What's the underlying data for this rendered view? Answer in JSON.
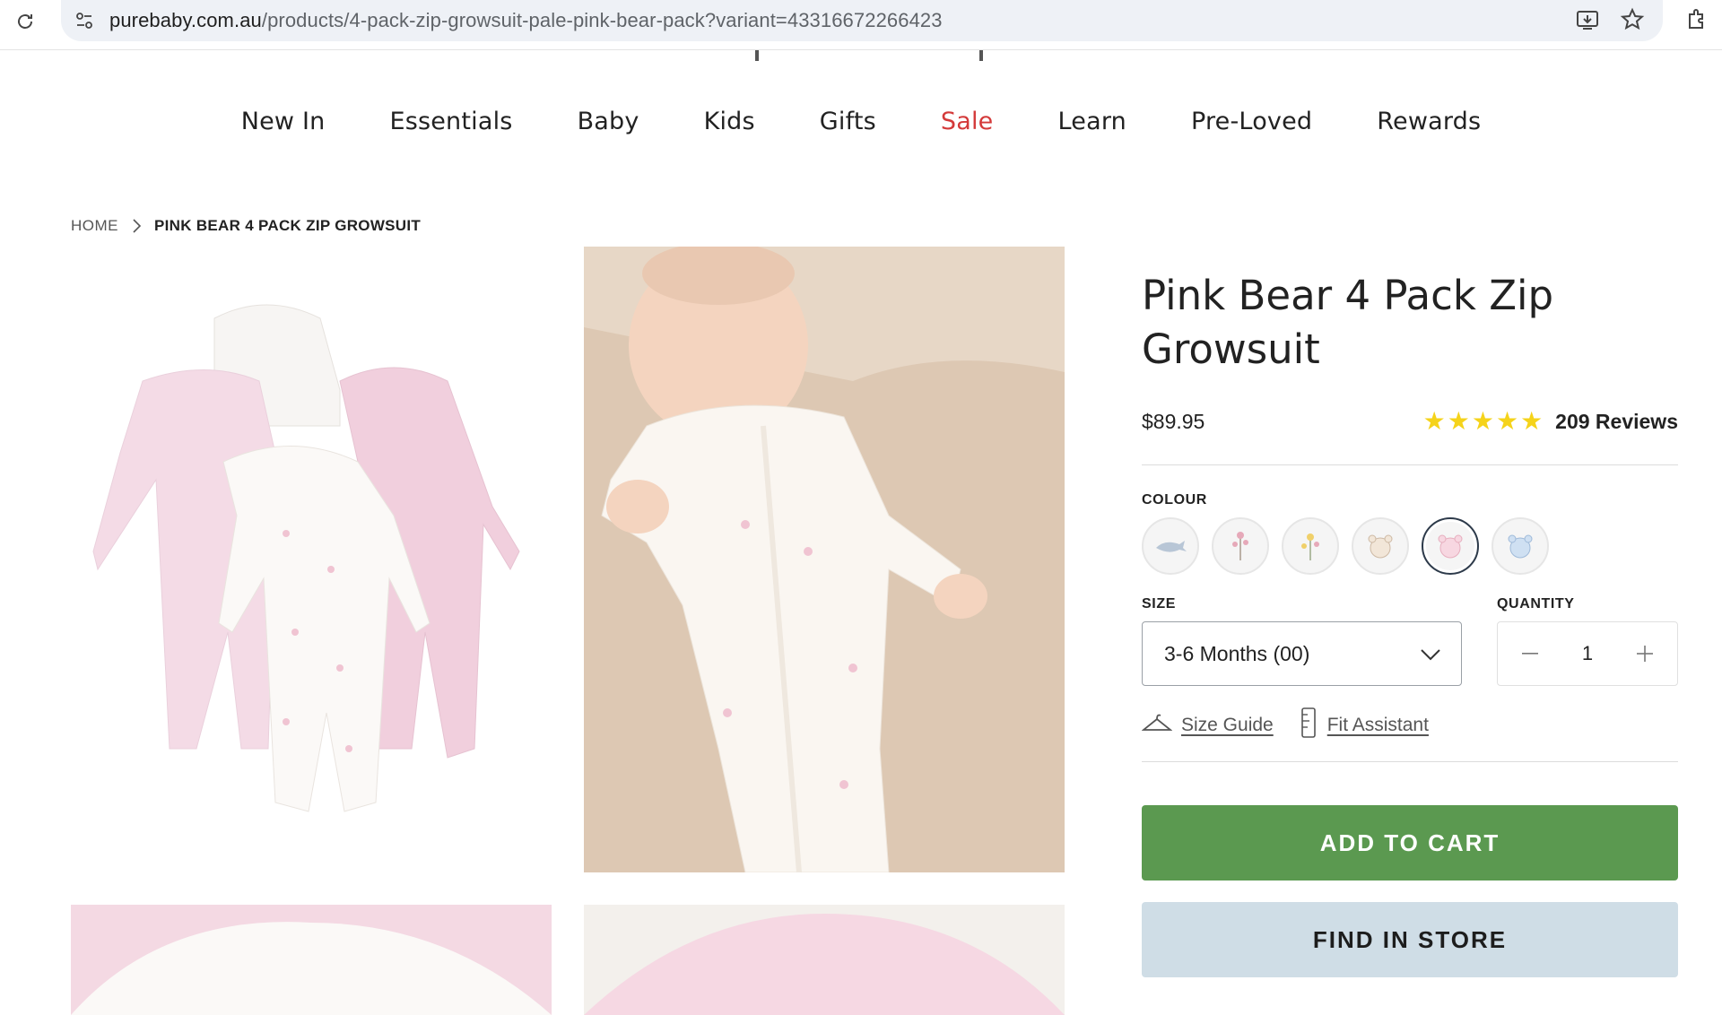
{
  "browser": {
    "url_domain": "purebaby.com.au",
    "url_path": "/products/4-pack-zip-growsuit-pale-pink-bear-pack?variant=43316672266423"
  },
  "nav": {
    "items": [
      {
        "label": "New In"
      },
      {
        "label": "Essentials"
      },
      {
        "label": "Baby"
      },
      {
        "label": "Kids"
      },
      {
        "label": "Gifts"
      },
      {
        "label": "Sale",
        "highlight": "#d43a3a"
      },
      {
        "label": "Learn"
      },
      {
        "label": "Pre-Loved"
      },
      {
        "label": "Rewards"
      }
    ]
  },
  "breadcrumb": {
    "home": "HOME",
    "current": "PINK BEAR 4 PACK ZIP GROWSUIT"
  },
  "product": {
    "title": "Pink Bear 4 Pack Zip Growsuit",
    "price": "$89.95",
    "rating_stars": 5,
    "reviews": "209 Reviews",
    "colour_label": "COLOUR",
    "swatches": [
      {
        "name": "whale",
        "active": false
      },
      {
        "name": "pink-floral",
        "active": false
      },
      {
        "name": "yellow-floral",
        "active": false
      },
      {
        "name": "cream-bear",
        "active": false
      },
      {
        "name": "pink-bear",
        "active": true
      },
      {
        "name": "blue-bear",
        "active": false
      }
    ],
    "size_label": "SIZE",
    "size_value": "3-6 Months (00)",
    "quantity_label": "QUANTITY",
    "quantity_value": "1",
    "size_guide": "Size Guide",
    "fit_assistant": "Fit Assistant",
    "add_to_cart": "ADD TO CART",
    "find_in_store": "FIND IN STORE"
  },
  "colors": {
    "accent_green": "#5b9950",
    "store_blue": "#cfdde6",
    "sale_red": "#d43a3a",
    "star_yellow": "#f5d31a"
  }
}
